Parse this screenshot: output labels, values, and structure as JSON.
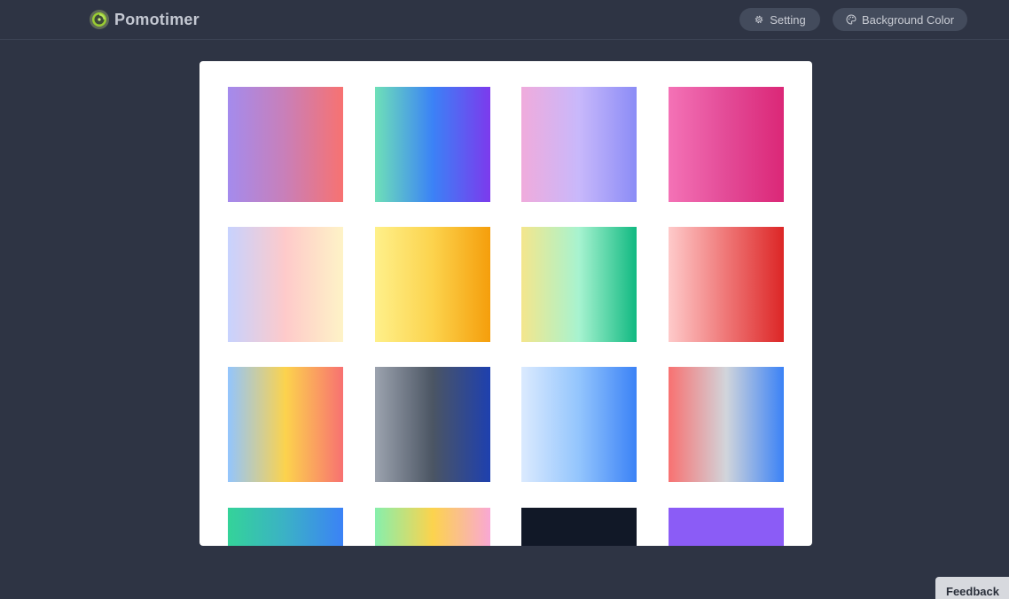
{
  "header": {
    "brand_name": "Pomotimer",
    "brand_icon": "pomotimer-logo-icon",
    "setting_label": "Setting",
    "setting_icon": "gear-icon",
    "background_label": "Background Color",
    "background_icon": "palette-icon"
  },
  "colors": {
    "page_background": "#2e3444",
    "header_button_bg": "#434b5c",
    "modal_background": "#ffffff"
  },
  "swatches": [
    {
      "name": "swatch-purple-coral",
      "gradient": [
        "#a48bed",
        "#c97fb8",
        "#f77271"
      ]
    },
    {
      "name": "swatch-teal-blue-violet",
      "gradient": [
        "#6ee0b8",
        "#3b82f6",
        "#7c3aed"
      ]
    },
    {
      "name": "swatch-pink-lavender-periwinkle",
      "gradient": [
        "#f0abdc",
        "#c8b8fb",
        "#8b8cf6"
      ]
    },
    {
      "name": "swatch-pink-magenta",
      "gradient": [
        "#f472b6",
        "#e34b97",
        "#db2777"
      ]
    },
    {
      "name": "swatch-lavender-peach-cream",
      "gradient": [
        "#c7d2fe",
        "#fecaca",
        "#fef3c7"
      ]
    },
    {
      "name": "swatch-cream-yellow-orange",
      "gradient": [
        "#fef08a",
        "#fcd34d",
        "#f59e0b"
      ]
    },
    {
      "name": "swatch-yellow-mint-green",
      "gradient": [
        "#f4e68c",
        "#a7f3d0",
        "#10b981"
      ]
    },
    {
      "name": "swatch-pink-red",
      "gradient": [
        "#fecaca",
        "#ef7777",
        "#dc2626"
      ]
    },
    {
      "name": "swatch-blue-yellow-coral",
      "gradient": [
        "#93c5fd",
        "#fcd34d",
        "#f87171"
      ]
    },
    {
      "name": "swatch-gray-navy",
      "gradient": [
        "#9ca3af",
        "#4b5563",
        "#1e40af"
      ]
    },
    {
      "name": "swatch-lightblue-blue",
      "gradient": [
        "#dbeafe",
        "#93c5fd",
        "#3b82f6"
      ]
    },
    {
      "name": "swatch-coral-gray-blue",
      "gradient": [
        "#f87171",
        "#d1d5db",
        "#3b82f6"
      ]
    },
    {
      "name": "swatch-teal-blue",
      "gradient": [
        "#34d399",
        "#3bb1c6",
        "#3b82f6"
      ]
    },
    {
      "name": "swatch-green-yellow-pink",
      "gradient": [
        "#86efac",
        "#fcd34d",
        "#f9a8d4"
      ]
    },
    {
      "name": "swatch-dark-navy",
      "gradient": [
        "#111827",
        "#111827",
        "#111827"
      ]
    },
    {
      "name": "swatch-violet",
      "gradient": [
        "#8b5cf6",
        "#8b5cf6",
        "#8b5cf6"
      ]
    }
  ],
  "feedback": {
    "label": "Feedback"
  }
}
